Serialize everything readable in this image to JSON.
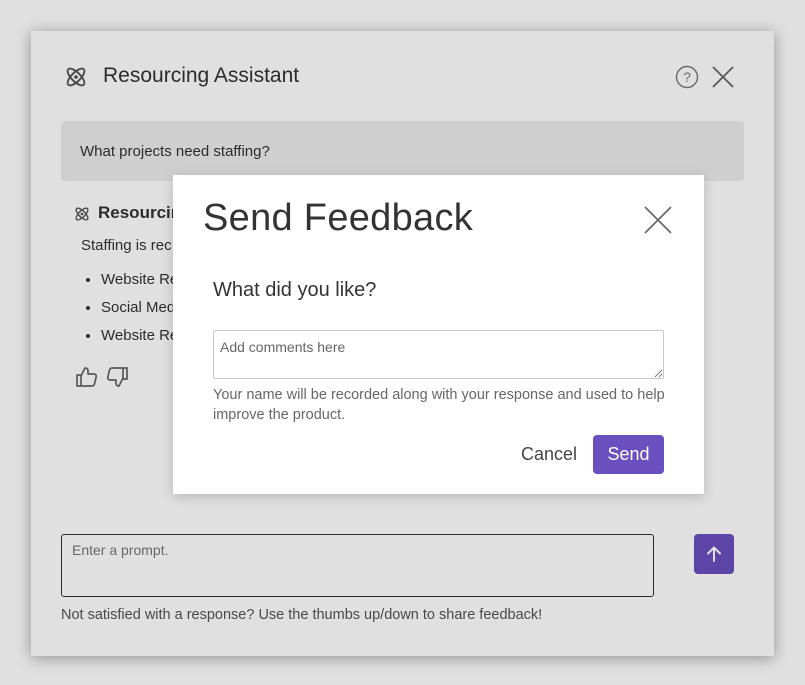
{
  "colors": {
    "accent": "#6a4fbf",
    "panel_bg": "#ffffff",
    "user_bubble_bg": "#ececec"
  },
  "header": {
    "app_icon": "atom-icon",
    "title": "Resourcing Assistant",
    "help_icon": "question-circle-icon",
    "close_icon": "close-icon"
  },
  "conversation": {
    "user_message": "What projects need staffing?",
    "assistant": {
      "icon": "atom-icon",
      "name_visible": "Resourcin",
      "text_visible": "Staffing is rec",
      "items": [
        "Website Re",
        "Social Med",
        "Website Re"
      ],
      "feedback_icons": [
        "thumbs-up-icon",
        "thumbs-down-icon"
      ]
    }
  },
  "prompt": {
    "placeholder": "Enter a prompt.",
    "send_icon": "arrow-up-icon"
  },
  "footer_note": "Not satisfied with a response? Use the thumbs up/down to share feedback!",
  "modal": {
    "title": "Send Feedback",
    "close_icon": "close-icon",
    "question": "What did you like?",
    "input_placeholder": "Add comments here",
    "note": "Your name will be recorded along with your response and used to help improve the product.",
    "cancel_label": "Cancel",
    "send_label": "Send"
  }
}
